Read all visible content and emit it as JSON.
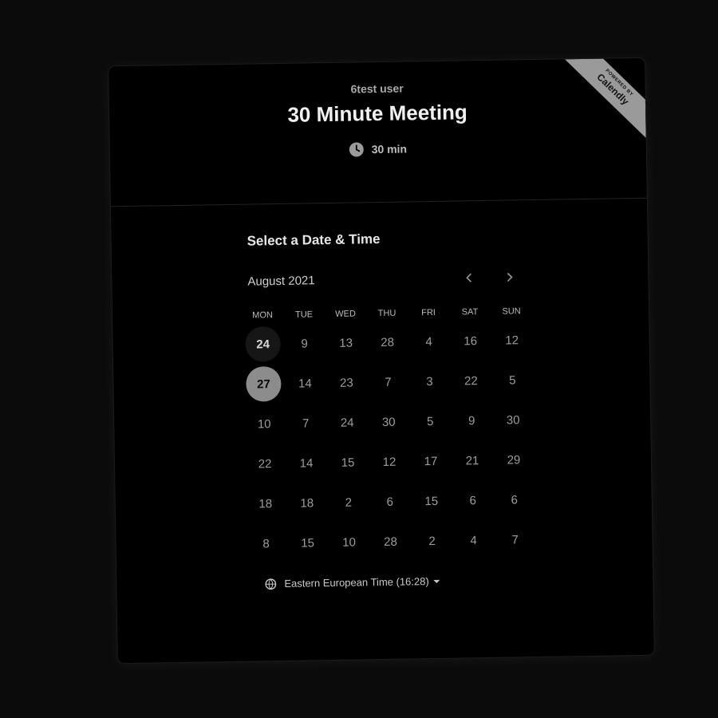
{
  "header": {
    "owner": "6test user",
    "event_title": "30 Minute Meeting",
    "duration": "30 min",
    "duration_icon": "clock-icon",
    "ribbon_small": "POWERED BY",
    "ribbon_brand": "Calendly"
  },
  "scheduler": {
    "section_title": "Select a Date & Time",
    "month_label": "August 2021",
    "prev_icon": "chevron-left-icon",
    "next_icon": "chevron-right-icon",
    "weekdays": [
      "MON",
      "TUE",
      "WED",
      "THU",
      "FRI",
      "SAT",
      "SUN"
    ],
    "weeks": [
      [
        "24",
        "9",
        "13",
        "28",
        "4",
        "16",
        "12"
      ],
      [
        "27",
        "14",
        "23",
        "7",
        "3",
        "22",
        "5"
      ],
      [
        "10",
        "7",
        "24",
        "30",
        "5",
        "9",
        "30"
      ],
      [
        "22",
        "14",
        "15",
        "12",
        "17",
        "21",
        "29"
      ],
      [
        "18",
        "18",
        "2",
        "6",
        "15",
        "6",
        "6"
      ],
      [
        "8",
        "15",
        "10",
        "28",
        "2",
        "4",
        "7"
      ]
    ],
    "available_day": {
      "week": 0,
      "day": 0
    },
    "selected_day": {
      "week": 1,
      "day": 0
    },
    "timezone_label": "Eastern European Time (16:28)",
    "timezone_icon": "globe-icon"
  },
  "colors": {
    "background": "#000000",
    "selected": "#8c8c8c",
    "available": "#161616",
    "ribbon": "#9a9a9a"
  }
}
